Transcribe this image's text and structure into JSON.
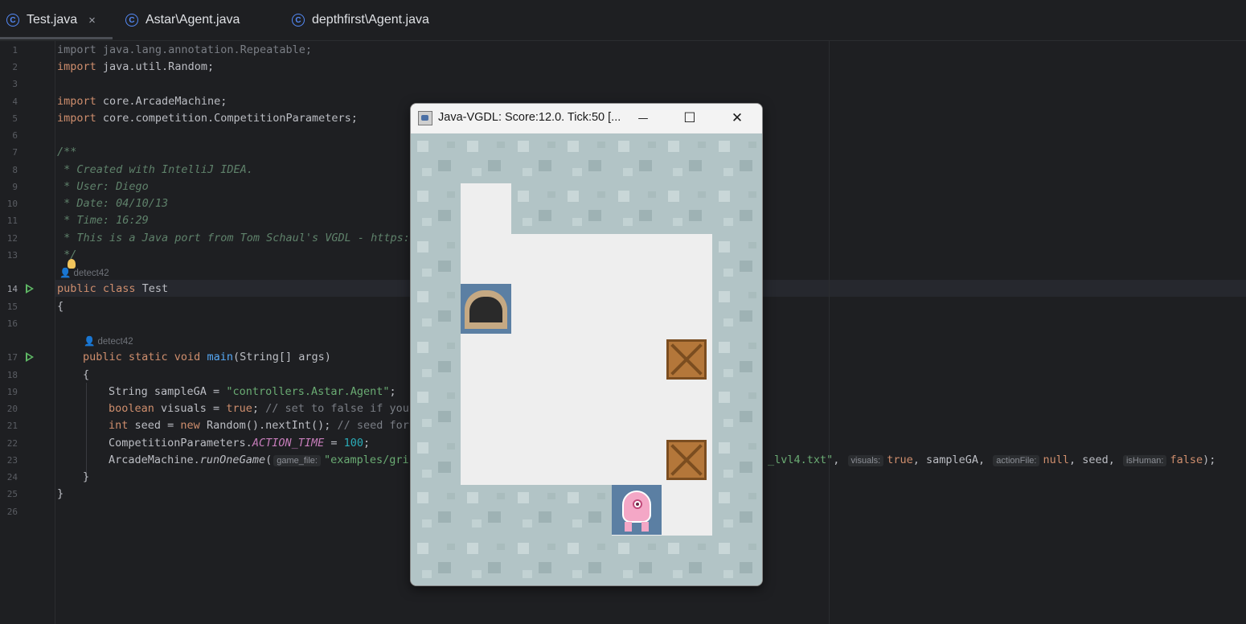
{
  "tabs": [
    {
      "label": "Test.java",
      "active": true,
      "icon": "class-icon"
    },
    {
      "label": "Astar\\Agent.java",
      "active": false,
      "icon": "class-icon"
    },
    {
      "label": "depthfirst\\Agent.java",
      "active": false,
      "icon": "class-icon"
    }
  ],
  "tab_close_glyph": "×",
  "class_icon_glyph": "C",
  "line_numbers": [
    "1",
    "2",
    "3",
    "4",
    "5",
    "6",
    "7",
    "8",
    "9",
    "10",
    "11",
    "12",
    "13",
    "14",
    "15",
    "16",
    "17",
    "18",
    "19",
    "20",
    "21",
    "22",
    "23",
    "24",
    "25",
    "26"
  ],
  "code": {
    "l1": "import java.lang.annotation.Repeatable;",
    "l2": "import java.util.Random;",
    "l4": "import core.ArcadeMachine;",
    "l5": "import core.competition.CompetitionParameters;",
    "l7": "/**",
    "l8": " * Created with IntelliJ IDEA.",
    "l9": " * User: Diego",
    "l10": " * Date: 04/10/13",
    "l11": " * Time: 16:29",
    "l12": " * This is a Java port from Tom Schaul's VGDL - https:/",
    "l13": " */",
    "author_a": "detect42",
    "author_b": "detect42",
    "l14_kw": "public class",
    "l14_name": " Test",
    "l15": "{",
    "l17_kw": "public static void",
    "l17_fn": "main",
    "l17_rest": "(String[] args)",
    "l18": "{",
    "l19_a": "String sampleGA = ",
    "l19_str": "\"controllers.Astar.Agent\"",
    "l19_end": ";",
    "l20_kw": "boolean",
    "l20_a": " visuals = ",
    "l20_true": "true",
    "l20_b": ";",
    "l20_cm": " // set to false if you",
    "l21_kw": "int",
    "l21_a": " seed = ",
    "l21_new": "new",
    "l21_b": " Random().nextInt(); ",
    "l21_cm": "// seed for",
    "l22_a": "CompetitionParameters.",
    "l22_sf": "ACTION_TIME",
    "l22_b": " = ",
    "l22_num": "100",
    "l22_c": ";",
    "l23_a": "ArcadeMachine.",
    "l23_fn": "runOneGame",
    "l23_b": "(",
    "l23_hint1": "game_file:",
    "l23_str1": "\"examples/gri",
    "l23_str2": "_lvl4.txt\"",
    "l23_c": ", ",
    "l23_hint2": "visuals:",
    "l23_true": "true",
    "l23_d": ", sampleGA, ",
    "l23_hint3": "actionFile:",
    "l23_null": "null",
    "l23_e": ", seed, ",
    "l23_hint4": "isHuman:",
    "l23_false": "false",
    "l23_f": ");",
    "l24": "}",
    "l25": "}"
  },
  "game_window": {
    "title": "Java-VGDL: Score:12.0. Tick:50 [...",
    "minimize_glyph": "—",
    "maximize_glyph": "☐",
    "close_glyph": "✕",
    "grid_rows": [
      "WWWWWWW",
      "W.WWWWW",
      "W.....W",
      "WH....W",
      "W....BW",
      "W.....W",
      "W....BW",
      "WWWWA.W",
      "WWWWWWW"
    ]
  },
  "colors": {
    "editor_bg": "#1e1f22",
    "keyword": "#cf8e6d",
    "string": "#6aab73",
    "doc_comment": "#5f826b",
    "number": "#2aacb8",
    "function": "#56a8f5",
    "static_field": "#c77dbb",
    "run_icon": "#5fb865"
  }
}
